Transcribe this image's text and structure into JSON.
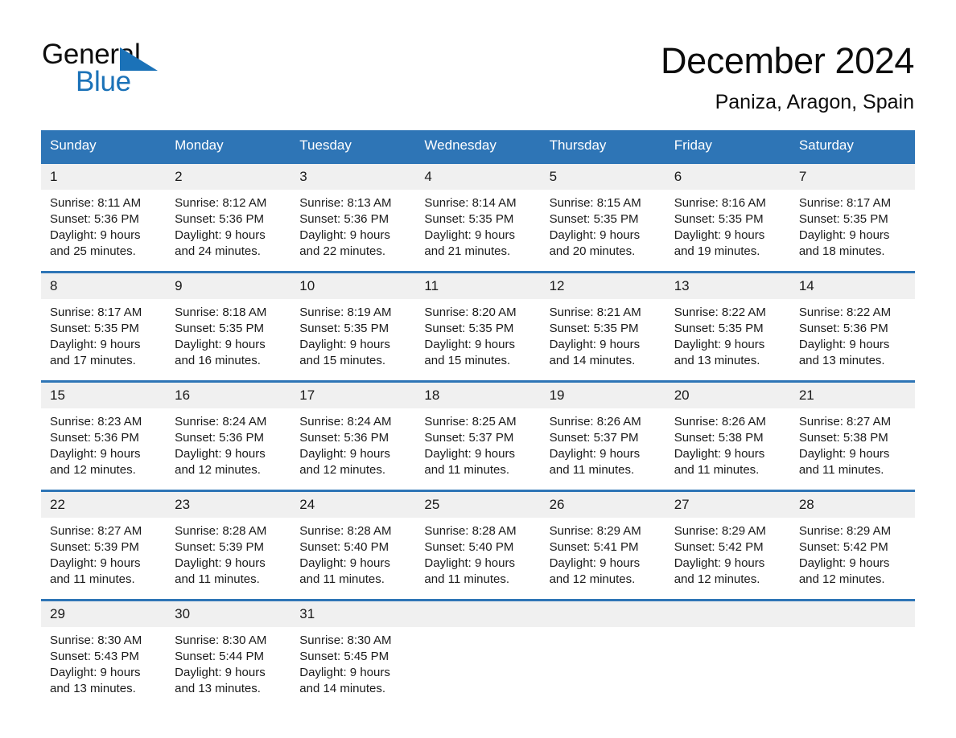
{
  "brand": {
    "name_part1": "General",
    "name_part2": "Blue",
    "accent_color": "#1b72b8"
  },
  "header": {
    "month_title": "December 2024",
    "location": "Paniza, Aragon, Spain"
  },
  "theme": {
    "header_blue": "#2e75b6",
    "daynum_gray": "#f0f0f0",
    "text_color": "#1a1a1a"
  },
  "calendar": {
    "weekdays": [
      "Sunday",
      "Monday",
      "Tuesday",
      "Wednesday",
      "Thursday",
      "Friday",
      "Saturday"
    ],
    "weeks": [
      [
        {
          "day": "1",
          "sunrise": "Sunrise: 8:11 AM",
          "sunset": "Sunset: 5:36 PM",
          "daylight1": "Daylight: 9 hours",
          "daylight2": "and 25 minutes."
        },
        {
          "day": "2",
          "sunrise": "Sunrise: 8:12 AM",
          "sunset": "Sunset: 5:36 PM",
          "daylight1": "Daylight: 9 hours",
          "daylight2": "and 24 minutes."
        },
        {
          "day": "3",
          "sunrise": "Sunrise: 8:13 AM",
          "sunset": "Sunset: 5:36 PM",
          "daylight1": "Daylight: 9 hours",
          "daylight2": "and 22 minutes."
        },
        {
          "day": "4",
          "sunrise": "Sunrise: 8:14 AM",
          "sunset": "Sunset: 5:35 PM",
          "daylight1": "Daylight: 9 hours",
          "daylight2": "and 21 minutes."
        },
        {
          "day": "5",
          "sunrise": "Sunrise: 8:15 AM",
          "sunset": "Sunset: 5:35 PM",
          "daylight1": "Daylight: 9 hours",
          "daylight2": "and 20 minutes."
        },
        {
          "day": "6",
          "sunrise": "Sunrise: 8:16 AM",
          "sunset": "Sunset: 5:35 PM",
          "daylight1": "Daylight: 9 hours",
          "daylight2": "and 19 minutes."
        },
        {
          "day": "7",
          "sunrise": "Sunrise: 8:17 AM",
          "sunset": "Sunset: 5:35 PM",
          "daylight1": "Daylight: 9 hours",
          "daylight2": "and 18 minutes."
        }
      ],
      [
        {
          "day": "8",
          "sunrise": "Sunrise: 8:17 AM",
          "sunset": "Sunset: 5:35 PM",
          "daylight1": "Daylight: 9 hours",
          "daylight2": "and 17 minutes."
        },
        {
          "day": "9",
          "sunrise": "Sunrise: 8:18 AM",
          "sunset": "Sunset: 5:35 PM",
          "daylight1": "Daylight: 9 hours",
          "daylight2": "and 16 minutes."
        },
        {
          "day": "10",
          "sunrise": "Sunrise: 8:19 AM",
          "sunset": "Sunset: 5:35 PM",
          "daylight1": "Daylight: 9 hours",
          "daylight2": "and 15 minutes."
        },
        {
          "day": "11",
          "sunrise": "Sunrise: 8:20 AM",
          "sunset": "Sunset: 5:35 PM",
          "daylight1": "Daylight: 9 hours",
          "daylight2": "and 15 minutes."
        },
        {
          "day": "12",
          "sunrise": "Sunrise: 8:21 AM",
          "sunset": "Sunset: 5:35 PM",
          "daylight1": "Daylight: 9 hours",
          "daylight2": "and 14 minutes."
        },
        {
          "day": "13",
          "sunrise": "Sunrise: 8:22 AM",
          "sunset": "Sunset: 5:35 PM",
          "daylight1": "Daylight: 9 hours",
          "daylight2": "and 13 minutes."
        },
        {
          "day": "14",
          "sunrise": "Sunrise: 8:22 AM",
          "sunset": "Sunset: 5:36 PM",
          "daylight1": "Daylight: 9 hours",
          "daylight2": "and 13 minutes."
        }
      ],
      [
        {
          "day": "15",
          "sunrise": "Sunrise: 8:23 AM",
          "sunset": "Sunset: 5:36 PM",
          "daylight1": "Daylight: 9 hours",
          "daylight2": "and 12 minutes."
        },
        {
          "day": "16",
          "sunrise": "Sunrise: 8:24 AM",
          "sunset": "Sunset: 5:36 PM",
          "daylight1": "Daylight: 9 hours",
          "daylight2": "and 12 minutes."
        },
        {
          "day": "17",
          "sunrise": "Sunrise: 8:24 AM",
          "sunset": "Sunset: 5:36 PM",
          "daylight1": "Daylight: 9 hours",
          "daylight2": "and 12 minutes."
        },
        {
          "day": "18",
          "sunrise": "Sunrise: 8:25 AM",
          "sunset": "Sunset: 5:37 PM",
          "daylight1": "Daylight: 9 hours",
          "daylight2": "and 11 minutes."
        },
        {
          "day": "19",
          "sunrise": "Sunrise: 8:26 AM",
          "sunset": "Sunset: 5:37 PM",
          "daylight1": "Daylight: 9 hours",
          "daylight2": "and 11 minutes."
        },
        {
          "day": "20",
          "sunrise": "Sunrise: 8:26 AM",
          "sunset": "Sunset: 5:38 PM",
          "daylight1": "Daylight: 9 hours",
          "daylight2": "and 11 minutes."
        },
        {
          "day": "21",
          "sunrise": "Sunrise: 8:27 AM",
          "sunset": "Sunset: 5:38 PM",
          "daylight1": "Daylight: 9 hours",
          "daylight2": "and 11 minutes."
        }
      ],
      [
        {
          "day": "22",
          "sunrise": "Sunrise: 8:27 AM",
          "sunset": "Sunset: 5:39 PM",
          "daylight1": "Daylight: 9 hours",
          "daylight2": "and 11 minutes."
        },
        {
          "day": "23",
          "sunrise": "Sunrise: 8:28 AM",
          "sunset": "Sunset: 5:39 PM",
          "daylight1": "Daylight: 9 hours",
          "daylight2": "and 11 minutes."
        },
        {
          "day": "24",
          "sunrise": "Sunrise: 8:28 AM",
          "sunset": "Sunset: 5:40 PM",
          "daylight1": "Daylight: 9 hours",
          "daylight2": "and 11 minutes."
        },
        {
          "day": "25",
          "sunrise": "Sunrise: 8:28 AM",
          "sunset": "Sunset: 5:40 PM",
          "daylight1": "Daylight: 9 hours",
          "daylight2": "and 11 minutes."
        },
        {
          "day": "26",
          "sunrise": "Sunrise: 8:29 AM",
          "sunset": "Sunset: 5:41 PM",
          "daylight1": "Daylight: 9 hours",
          "daylight2": "and 12 minutes."
        },
        {
          "day": "27",
          "sunrise": "Sunrise: 8:29 AM",
          "sunset": "Sunset: 5:42 PM",
          "daylight1": "Daylight: 9 hours",
          "daylight2": "and 12 minutes."
        },
        {
          "day": "28",
          "sunrise": "Sunrise: 8:29 AM",
          "sunset": "Sunset: 5:42 PM",
          "daylight1": "Daylight: 9 hours",
          "daylight2": "and 12 minutes."
        }
      ],
      [
        {
          "day": "29",
          "sunrise": "Sunrise: 8:30 AM",
          "sunset": "Sunset: 5:43 PM",
          "daylight1": "Daylight: 9 hours",
          "daylight2": "and 13 minutes."
        },
        {
          "day": "30",
          "sunrise": "Sunrise: 8:30 AM",
          "sunset": "Sunset: 5:44 PM",
          "daylight1": "Daylight: 9 hours",
          "daylight2": "and 13 minutes."
        },
        {
          "day": "31",
          "sunrise": "Sunrise: 8:30 AM",
          "sunset": "Sunset: 5:45 PM",
          "daylight1": "Daylight: 9 hours",
          "daylight2": "and 14 minutes."
        },
        {
          "day": "",
          "sunrise": "",
          "sunset": "",
          "daylight1": "",
          "daylight2": ""
        },
        {
          "day": "",
          "sunrise": "",
          "sunset": "",
          "daylight1": "",
          "daylight2": ""
        },
        {
          "day": "",
          "sunrise": "",
          "sunset": "",
          "daylight1": "",
          "daylight2": ""
        },
        {
          "day": "",
          "sunrise": "",
          "sunset": "",
          "daylight1": "",
          "daylight2": ""
        }
      ]
    ]
  }
}
